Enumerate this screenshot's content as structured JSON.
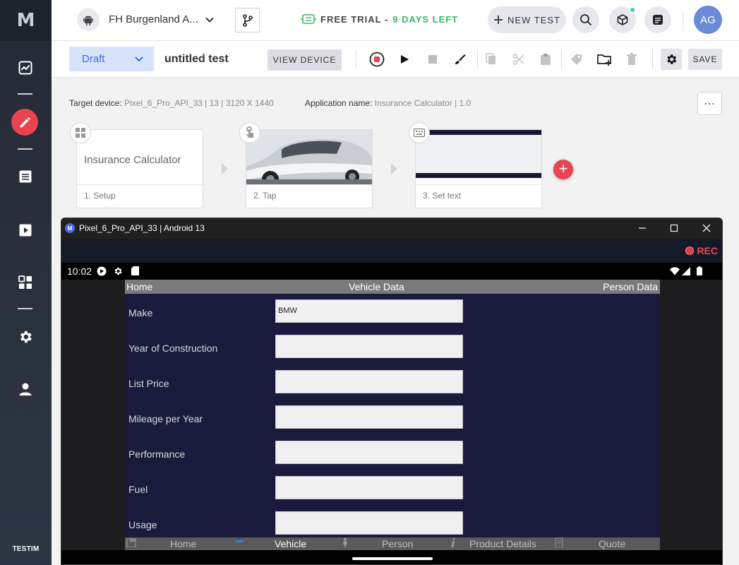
{
  "sidebar": {
    "logo": "M",
    "brand": "TESTIM"
  },
  "topbar": {
    "project_name": "FH Burgenland A...",
    "trial_label": "FREE TRIAL -",
    "trial_days": "9 DAYS LEFT",
    "new_test_label": "NEW TEST",
    "avatar_initials": "AG"
  },
  "toolbar": {
    "status": "Draft",
    "test_name": "untitled test",
    "view_device_label": "VIEW DEVICE",
    "save_label": "SAVE"
  },
  "info": {
    "target_device_label": "Target device:",
    "target_device_value": "Pixel_6_Pro_API_33 | 13 | 3120 X 1440",
    "app_name_label": "Application name:",
    "app_name_value": "Insurance Calculator | 1.0",
    "more_label": "⋯"
  },
  "steps": [
    {
      "label": "1. Setup",
      "thumb_text": "Insurance Calculator"
    },
    {
      "label": "2. Tap"
    },
    {
      "label": "3. Set text"
    }
  ],
  "emulator": {
    "title": "Pixel_6_Pro_API_33 | Android 13",
    "logo": "M",
    "rec_label": "REC",
    "clock": "10:02",
    "tabs": {
      "left": "Home",
      "center": "Vehicle Data",
      "right": "Person Data"
    },
    "fields": [
      {
        "label": "Make",
        "value": "BMW"
      },
      {
        "label": "Year of Construction",
        "value": ""
      },
      {
        "label": "List Price",
        "value": ""
      },
      {
        "label": "Mileage per Year",
        "value": ""
      },
      {
        "label": "Performance",
        "value": ""
      },
      {
        "label": "Fuel",
        "value": ""
      },
      {
        "label": "Usage",
        "value": ""
      }
    ],
    "bottom_nav": [
      "Home",
      "Vehicle",
      "Person",
      "Product Details",
      "Quote"
    ]
  },
  "colors": {
    "accent_red": "#e8444f",
    "trial_green": "#3aba63",
    "draft_blue": "#3e6fd8",
    "app_bg": "#1a1a3d"
  }
}
